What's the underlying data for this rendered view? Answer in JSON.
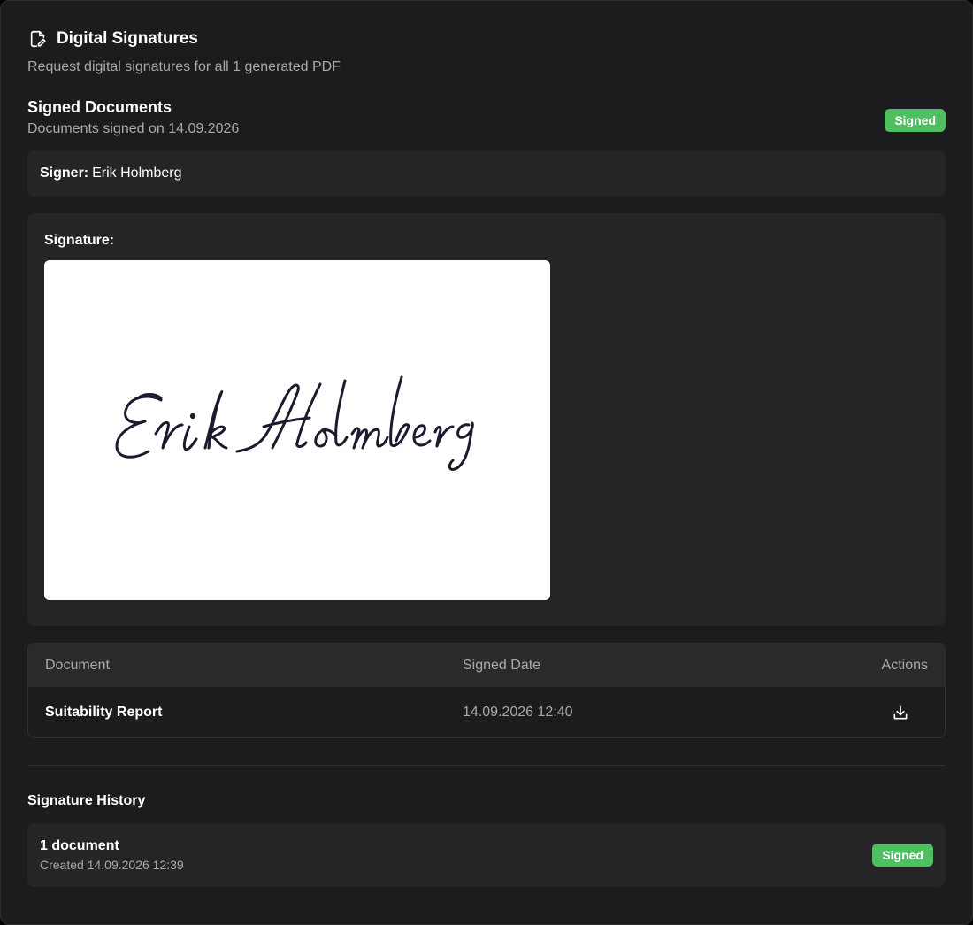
{
  "header": {
    "icon": "document-signature-icon",
    "title": "Digital Signatures",
    "description": "Request digital signatures for all 1 generated PDF"
  },
  "signed_documents": {
    "title": "Signed Documents",
    "subtitle": "Documents signed on 14.09.2026",
    "status_badge": "Signed"
  },
  "signer": {
    "label": "Signer:",
    "name": "Erik Holmberg"
  },
  "signature": {
    "label": "Signature:",
    "handwritten_text": "Erik Holmberg"
  },
  "documents_table": {
    "columns": [
      "Document",
      "Signed Date",
      "Actions"
    ],
    "rows": [
      {
        "document": "Suitability Report",
        "signed_date": "14.09.2026 12:40",
        "action_icon": "download-icon"
      }
    ]
  },
  "signature_history": {
    "title": "Signature History",
    "items": [
      {
        "count": "1 document",
        "created": "Created 14.09.2026 12:39",
        "status": "Signed"
      }
    ]
  },
  "colors": {
    "background": "#1c1c1e",
    "panel": "#252528",
    "badge_green": "#4fbf62",
    "muted_text": "#a9a9ad"
  }
}
